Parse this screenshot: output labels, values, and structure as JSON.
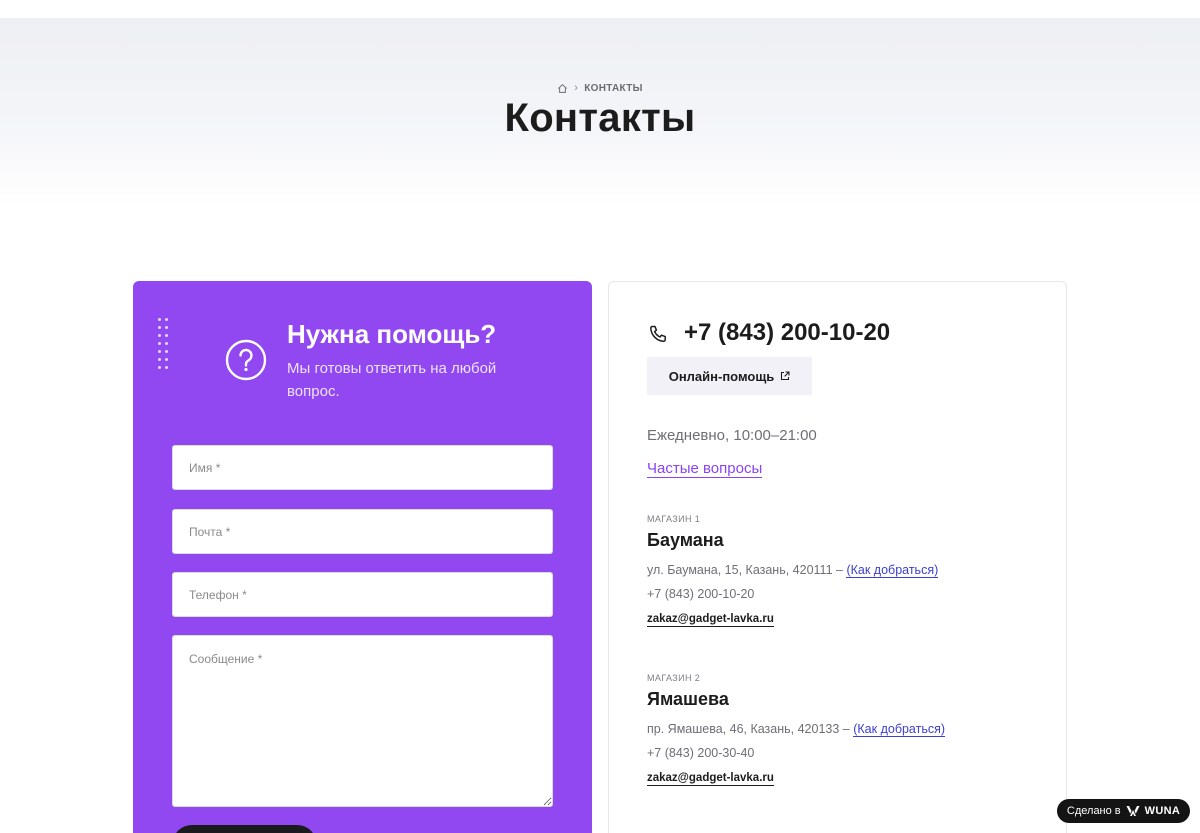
{
  "breadcrumb": {
    "home_icon": "home-icon",
    "current": "КОНТАКТЫ"
  },
  "page": {
    "title": "Контакты"
  },
  "help_form": {
    "title": "Нужна помощь?",
    "subtitle": "Мы готовы ответить на любой вопрос.",
    "icon": "question-circle-icon",
    "accent_color": "#9148f0",
    "fields": {
      "name_placeholder": "Имя *",
      "email_placeholder": "Почта *",
      "phone_placeholder": "Телефон *",
      "message_placeholder": "Сообщение *"
    }
  },
  "contacts": {
    "phone_icon": "phone-icon",
    "main_phone": "+7 (843) 200-10-20",
    "online_help_label": "Онлайн-помощь",
    "hours": "Ежедневно, 10:00–21:00",
    "faq_link": "Частые вопросы",
    "faq_color": "#8a43f0",
    "stores": [
      {
        "label": "МАГАЗИН 1",
        "name": "Баумана",
        "address": "ул. Баумана, 15, Казань, 420111 –",
        "route_link": "(Как добраться)",
        "phone": "+7 (843) 200-10-20",
        "email": "zakaz@gadget-lavka.ru"
      },
      {
        "label": "МАГАЗИН 2",
        "name": "Ямашева",
        "address": "пр. Ямашева, 46, Казань, 420133 –",
        "route_link": "(Как добраться)",
        "phone": "+7 (843) 200-30-40",
        "email": "zakaz@gadget-lavka.ru"
      }
    ]
  },
  "badge": {
    "made_in": "Сделано в",
    "brand": "WUNA"
  }
}
